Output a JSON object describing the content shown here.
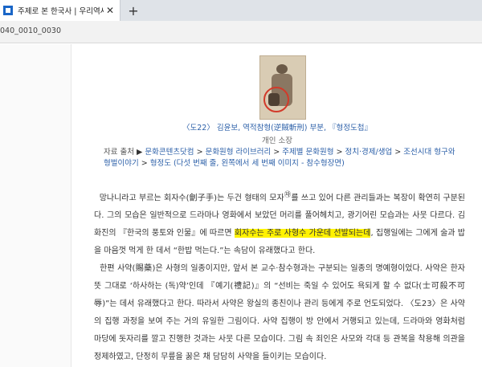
{
  "browser": {
    "tab": {
      "title": "주제로 본 한국사 | 우리역사넷",
      "close": "✕"
    },
    "new_tab": "+",
    "address": {
      "url": "040_0010_0030"
    }
  },
  "figure": {
    "caption": "〈도22〉 김윤보, 역적참형(逆賊斬刑) 부분, 『형정도첩』",
    "holder": "개인 소장"
  },
  "source": {
    "label": "자료 출처",
    "arrow": "▶",
    "links": [
      "문화콘텐츠닷컴",
      "문화원형 라이브러리",
      "주제별 문화원형",
      "정치·경제/생업",
      "조선시대 형구와 형벌이야기",
      "형정도 (다섯 번째 줄, 왼쪽에서 세 번째 이미지 - 참수형장면)"
    ],
    "separator": ">"
  },
  "article": {
    "p1_before": "망나니라고 부르는 회자수(劊子手)는 두건 형태의 모자",
    "p1_sup": "㉶",
    "p1_mid": "를 쓰고 있어 다른 관리들과는 복장이 확연히 구분된다. 그의 모습은 일반적으로 드라마나 영화에서 보았던 머리를 풀어헤치고, 광기어린 모습과는 사뭇 다르다. 김화진의 『한국의 풍토와 인물』에 따르면 ",
    "p1_highlight": "회자수는 주로 사형수 가운데 선발되는데",
    "p1_after": ", 집행일에는 그에게 술과 밥을 마음껏 먹게 한 데서 “한밥 먹는다.”는 속담이 유래했다고 한다.",
    "p2": "한편 사약(賜藥)은 사형의 일종이지만, 앞서 본 교수·참수형과는 구분되는 일종의 명예형이었다. 사약은 한자뜻 그대로 ‘하사하는 (독)약’인데 『예기(禮記)』의 “선비는 죽일 수 있어도 욕되게 할 수 없다(士可殺不可辱)”는 데서 유래했다고 한다. 따라서 사약은 왕실의 종친이나 관리 등에게 주로 언도되었다. 〈도23〉은 사약의 집행 과정을 보여 주는 거의 유일한 그림이다. 사약 집행이 방 안에서 거행되고 있는데, 드라마와 영화처럼 마당에 돗자리를 깔고 진행한 것과는 사뭇 다른 모습이다. 그림 속 죄인은 사모와 각대 등 관복을 착용해 의관을 정제하였고, 단정히 무릎을 꿇은 채 담담히 사약을 들이키는 모습이다."
  },
  "colors": {
    "link": "#2b5fa8",
    "highlight": "#fff200",
    "favicon": "#1a66c7"
  }
}
